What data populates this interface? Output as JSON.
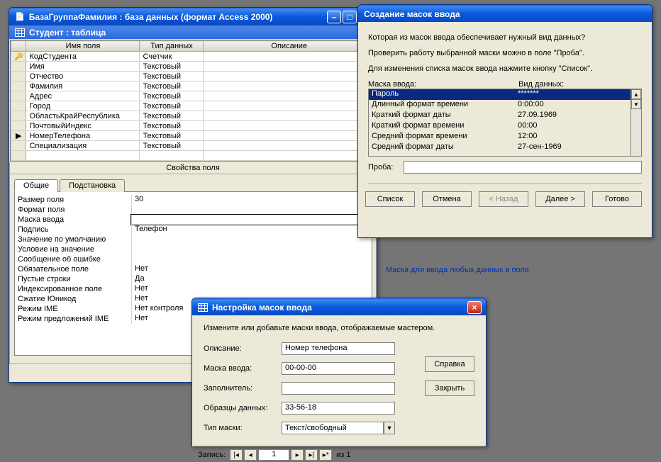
{
  "main_window": {
    "title": "БазаГруппаФамилия : база данных (формат Access 2000)",
    "subtitle": "Студент : таблица",
    "columns": {
      "name": "Имя поля",
      "type": "Тип данных",
      "desc": "Описание"
    },
    "rows": [
      {
        "sel": "key",
        "name": "КодСтудента",
        "type": "Счетчик"
      },
      {
        "sel": "",
        "name": "Имя",
        "type": "Текстовый"
      },
      {
        "sel": "",
        "name": "Отчество",
        "type": "Текстовый"
      },
      {
        "sel": "",
        "name": "Фамилия",
        "type": "Текстовый"
      },
      {
        "sel": "",
        "name": "Адрес",
        "type": "Текстовый"
      },
      {
        "sel": "",
        "name": "Город",
        "type": "Текстовый"
      },
      {
        "sel": "",
        "name": "ОбластьКрайРеспублика",
        "type": "Текстовый"
      },
      {
        "sel": "",
        "name": "ПочтовыйИндекс",
        "type": "Текстовый"
      },
      {
        "sel": "cur",
        "name": "НомерТелефона",
        "type": "Текстовый"
      },
      {
        "sel": "",
        "name": "Специализация",
        "type": "Текстовый"
      }
    ],
    "props_header": "Свойства поля",
    "tabs": {
      "general": "Общие",
      "lookup": "Подстановка"
    },
    "props": [
      {
        "label": "Размер поля",
        "val": "30"
      },
      {
        "label": "Формат поля",
        "val": ""
      },
      {
        "label": "Маска ввода",
        "val": ""
      },
      {
        "label": "Подпись",
        "val": "Телефон"
      },
      {
        "label": "Значение по умолчанию",
        "val": ""
      },
      {
        "label": "Условие на значение",
        "val": ""
      },
      {
        "label": "Сообщение об ошибке",
        "val": ""
      },
      {
        "label": "Обязательное поле",
        "val": "Нет"
      },
      {
        "label": "Пустые строки",
        "val": "Да"
      },
      {
        "label": "Индексированное поле",
        "val": "Нет"
      },
      {
        "label": "Сжатие Юникод",
        "val": "Нет"
      },
      {
        "label": "Режим IME",
        "val": "Нет контроля"
      },
      {
        "label": "Режим предложений IME",
        "val": "Нет"
      }
    ],
    "hint": "Маска для ввода любых данных в поле"
  },
  "wizard": {
    "title": "Создание масок ввода",
    "p1": "Которая из масок ввода обеспечивает нужный вид данных?",
    "p2": "Проверить работу выбранной маски можно в поле \"Проба\".",
    "p3": "Для изменения списка масок ввода нажмите кнопку \"Список\".",
    "col1": "Маска ввода:",
    "col2": "Вид данных:",
    "list": [
      {
        "name": "Пароль",
        "sample": "*******",
        "sel": true
      },
      {
        "name": "Длинный формат времени",
        "sample": "0:00:00"
      },
      {
        "name": "Краткий формат даты",
        "sample": "27.09.1969"
      },
      {
        "name": "Краткий формат времени",
        "sample": "00:00"
      },
      {
        "name": "Средний формат времени",
        "sample": "12:00"
      },
      {
        "name": "Средний формат даты",
        "sample": "27-сен-1969"
      }
    ],
    "proba_label": "Проба:",
    "buttons": {
      "list": "Список",
      "cancel": "Отмена",
      "back": "< Назад",
      "next": "Далее >",
      "finish": "Готово"
    }
  },
  "edit_mask": {
    "title": "Настройка масок ввода",
    "intro": "Измените или добавьте маски ввода, отображаемые мастером.",
    "fields": {
      "desc_label": "Описание:",
      "desc_val": "Номер телефона",
      "mask_label": "Маска ввода:",
      "mask_val": "00-00-00",
      "fill_label": "Заполнитель:",
      "fill_val": "",
      "sample_label": "Образцы данных:",
      "sample_val": "33-56-18",
      "type_label": "Тип маски:",
      "type_val": "Текст/свободный"
    },
    "side_buttons": {
      "help": "Справка",
      "close": "Закрыть"
    },
    "record": {
      "label": "Запись:",
      "cur": "1",
      "suffix": "из  1"
    }
  }
}
